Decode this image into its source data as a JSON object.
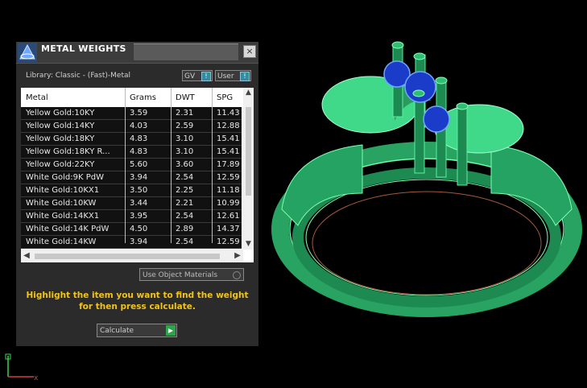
{
  "panel": {
    "title": "METAL WEIGHTS",
    "close_glyph": "×",
    "library_label": "Library: Classic - (Fast)-Metal",
    "toggles": [
      {
        "label": "GV",
        "icon": "toggle-icon"
      },
      {
        "label": "User",
        "icon": "toggle-icon"
      }
    ],
    "table": {
      "columns": [
        "Metal",
        "Grams",
        "DWT",
        "SPG"
      ],
      "rows": [
        [
          "Yellow Gold:10KY",
          "3.59",
          "2.31",
          "11.43"
        ],
        [
          "Yellow Gold:14KY",
          "4.03",
          "2.59",
          "12.88"
        ],
        [
          "Yellow Gold:18KY",
          "4.83",
          "3.10",
          "15.41"
        ],
        [
          "Yellow Gold:18KY R...",
          "4.83",
          "3.10",
          "15.41"
        ],
        [
          "Yellow Gold:22KY",
          "5.60",
          "3.60",
          "17.89"
        ],
        [
          "White Gold:9K PdW",
          "3.94",
          "2.54",
          "12.59"
        ],
        [
          "White Gold:10KX1",
          "3.50",
          "2.25",
          "11.18"
        ],
        [
          "White Gold:10KW",
          "3.44",
          "2.21",
          "10.99"
        ],
        [
          "White Gold:14KX1",
          "3.95",
          "2.54",
          "12.61"
        ],
        [
          "White Gold:14K PdW",
          "4.50",
          "2.89",
          "14.37"
        ],
        [
          "White Gold:14KW",
          "3.94",
          "2.54",
          "12.59"
        ]
      ]
    },
    "use_object_materials": "Use Object Materials",
    "hint": "Highlight the item you want to find the weight for then press calculate.",
    "calculate_label": "Calculate"
  },
  "viewport": {
    "axis_x_label": "x",
    "model_color": "#2fbf73",
    "gem_color": "#1a3cc8"
  }
}
